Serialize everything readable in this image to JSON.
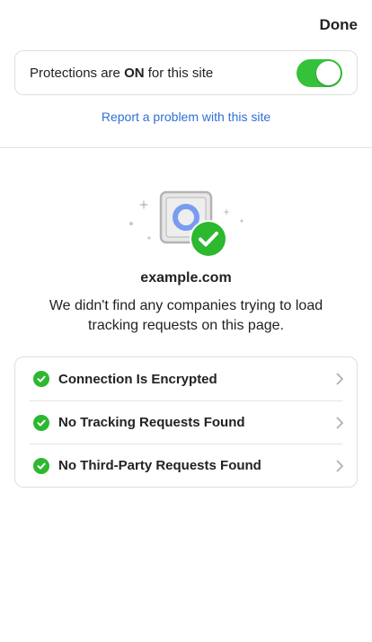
{
  "header": {
    "done_label": "Done"
  },
  "protection": {
    "prefix": "Protections are ",
    "state": "ON",
    "suffix": " for this site",
    "enabled": true
  },
  "report": {
    "link_label": "Report a problem with this site"
  },
  "site": {
    "domain": "example.com",
    "message": "We didn't find any companies trying to load tracking requests on this page."
  },
  "items": [
    {
      "label": "Connection Is Encrypted",
      "status_icon": "check-circle-icon"
    },
    {
      "label": "No Tracking Requests Found",
      "status_icon": "check-circle-icon"
    },
    {
      "label": "No Third-Party Requests Found",
      "status_icon": "check-circle-icon"
    }
  ],
  "colors": {
    "toggle_on": "#35c23a",
    "check_green": "#2cb82f",
    "link_blue": "#2f6fd8",
    "hero_ring": "#7a9cf0"
  }
}
